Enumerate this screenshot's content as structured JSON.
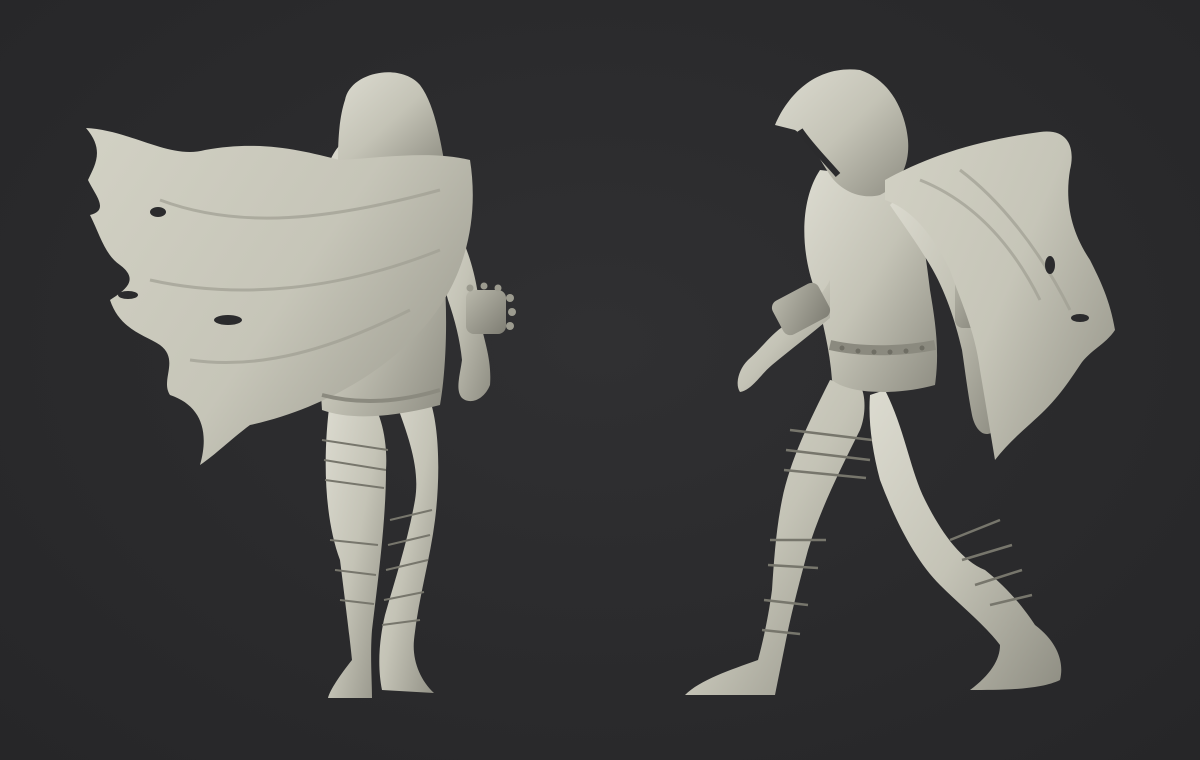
{
  "scene": {
    "background_color": "#2b2b2d",
    "sculpt_color": "#c9c8bb",
    "views": [
      {
        "name": "back-view"
      },
      {
        "name": "side-view"
      }
    ]
  }
}
